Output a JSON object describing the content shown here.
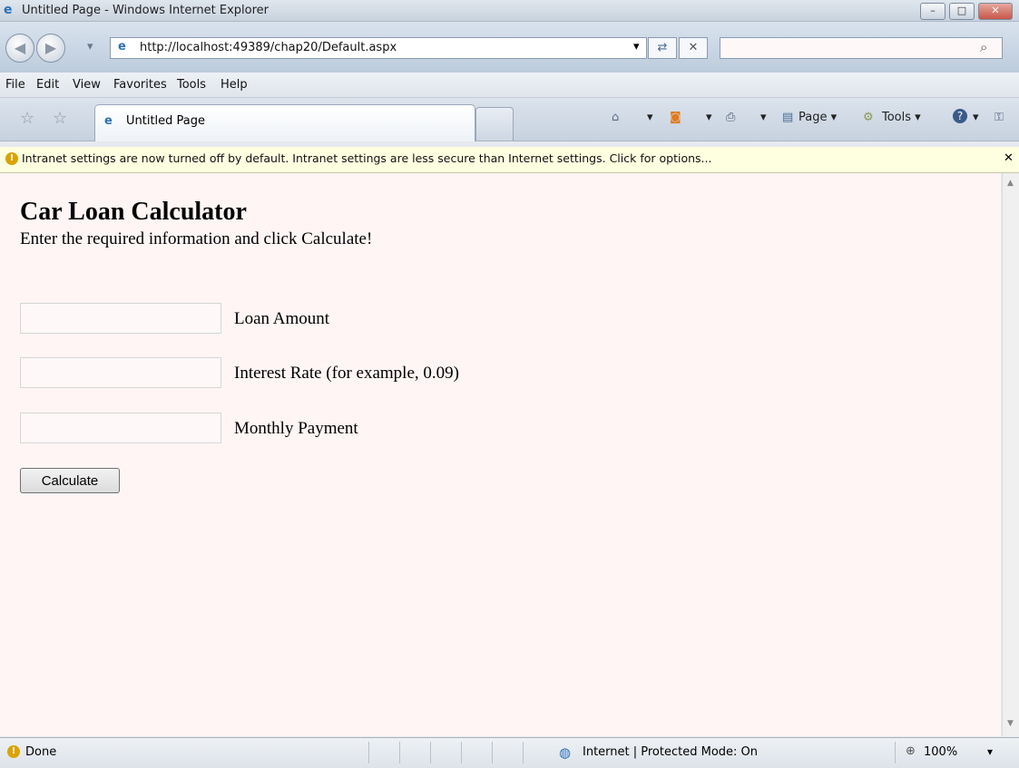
{
  "window": {
    "title": "Untitled Page - Windows Internet Explorer",
    "min": "–",
    "max": "□",
    "close": "✕"
  },
  "nav": {
    "back": "◀",
    "forward": "▶",
    "dropdown": "▾",
    "url": "http://localhost:49389/chap20/Default.aspx",
    "url_dropdown": "▾",
    "refresh": "⇄",
    "stop": "✕",
    "search_placeholder": "",
    "search_icon": "⌕"
  },
  "menu": [
    "File",
    "Edit",
    "View",
    "Favorites",
    "Tools",
    "Help"
  ],
  "tabs": {
    "active_label": "Untitled Page",
    "toolbar": {
      "page": "Page ▾",
      "tools": "Tools ▾",
      "help": "?"
    }
  },
  "infobar": {
    "message": "Intranet settings are now turned off by default. Intranet settings are less secure than Internet settings. Click for options...",
    "close": "✕"
  },
  "page": {
    "heading": "Car Loan Calculator",
    "subheading": "Enter the required information and click Calculate!",
    "fields": [
      {
        "label": "Loan Amount",
        "value": ""
      },
      {
        "label": "Interest Rate (for example, 0.09)",
        "value": ""
      },
      {
        "label": "Monthly Payment",
        "value": ""
      }
    ],
    "button": "Calculate"
  },
  "status": {
    "left": "Done",
    "zone": "Internet | Protected Mode: On",
    "zoom": "100%",
    "zoom_dropdown": "▾"
  },
  "colors": {
    "page_bg": "#fff5f5",
    "infobar_bg": "#fefee0",
    "chrome": "#d9e3ee"
  }
}
